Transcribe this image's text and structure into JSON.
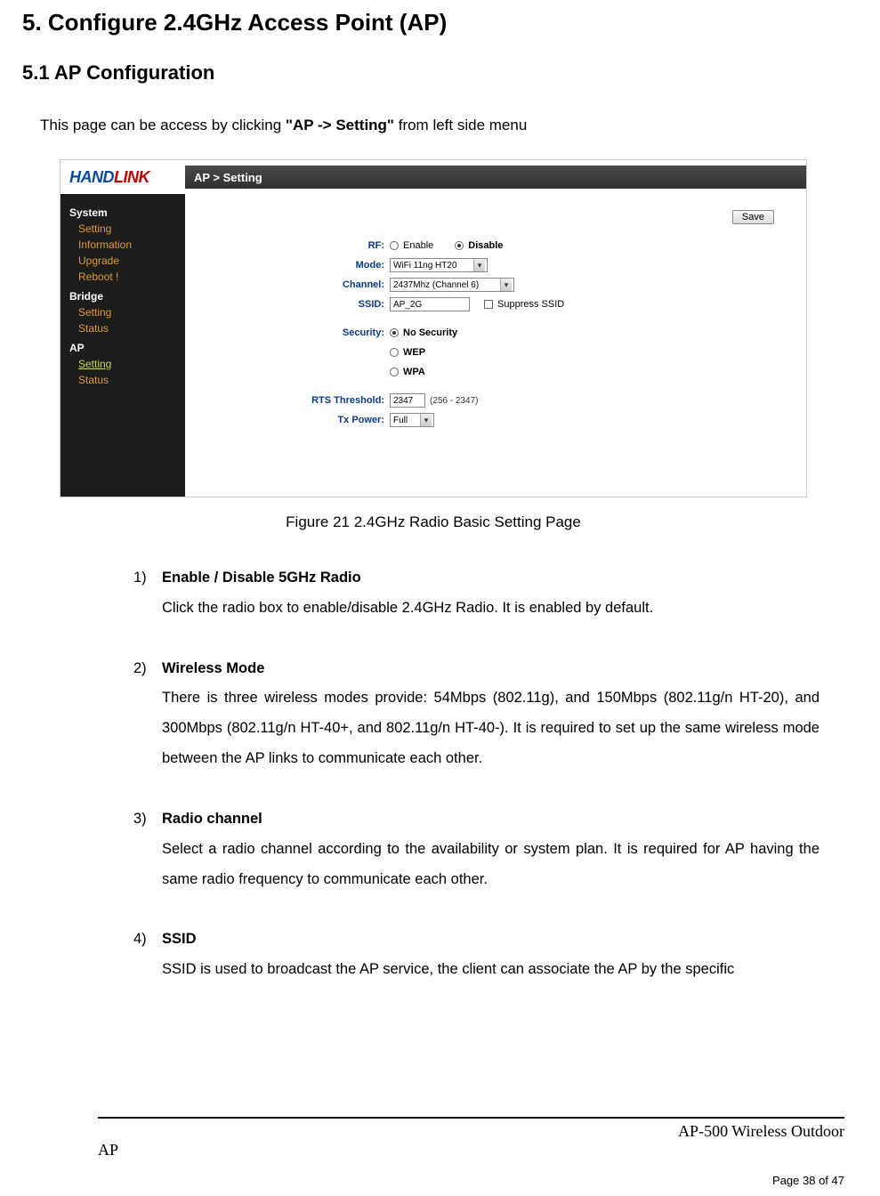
{
  "headings": {
    "h1": "5.  Configure 2.4GHz Access Point (AP)",
    "h2": "5.1    AP Configuration"
  },
  "intro": {
    "prefix": "This page can be access by clicking ",
    "bold": "\"AP -> Setting\"",
    "suffix": " from left side menu"
  },
  "screenshot": {
    "logo_hand": "HAND",
    "logo_link": "LINK",
    "crumb": "AP > Setting",
    "sidebar": {
      "system": "System",
      "system_items": {
        "setting": "Setting",
        "information": "Information",
        "upgrade": "Upgrade",
        "reboot": "Reboot !"
      },
      "bridge": "Bridge",
      "bridge_items": {
        "setting": "Setting",
        "status": "Status"
      },
      "ap": "AP",
      "ap_items": {
        "setting": "Setting",
        "status": "Status"
      }
    },
    "save_btn": "Save",
    "form": {
      "rf_label": "RF:",
      "rf_enable": "Enable",
      "rf_disable": "Disable",
      "mode_label": "Mode:",
      "mode_value": "WiFi 11ng HT20",
      "channel_label": "Channel:",
      "channel_value": "2437Mhz (Channel 6)",
      "ssid_label": "SSID:",
      "ssid_value": "AP_2G",
      "suppress": "Suppress SSID",
      "security_label": "Security:",
      "sec_none": "No Security",
      "sec_wep": "WEP",
      "sec_wpa": "WPA",
      "rts_label": "RTS Threshold:",
      "rts_value": "2347",
      "rts_range": "(256 - 2347)",
      "txpower_label": "Tx Power:",
      "txpower_value": "Full"
    }
  },
  "caption": "Figure 21    2.4GHz Radio Basic Setting Page",
  "list": {
    "i1": {
      "num": "1)",
      "title": "Enable / Disable 5GHz Radio",
      "body": "Click the radio box to enable/disable 2.4GHz Radio. It is enabled by default."
    },
    "i2": {
      "num": "2)",
      "title": "Wireless Mode",
      "body": "There is three wireless modes provide: 54Mbps (802.11g), and 150Mbps (802.11g/n HT-20), and 300Mbps (802.11g/n HT-40+, and 802.11g/n HT-40-). It is required to set up the same wireless mode between the AP links to communicate each other."
    },
    "i3": {
      "num": "3)",
      "title": "Radio channel",
      "body": "Select a radio channel according to the availability or system plan. It is required for AP having the same radio frequency to communicate each other."
    },
    "i4": {
      "num": "4)",
      "title": "SSID",
      "body": "SSID is used to broadcast the AP service, the client can associate the AP by the specific"
    }
  },
  "footer": {
    "left": "AP",
    "right": "AP-500    Wireless  Outdoor",
    "page": "Page 38 of 47"
  }
}
